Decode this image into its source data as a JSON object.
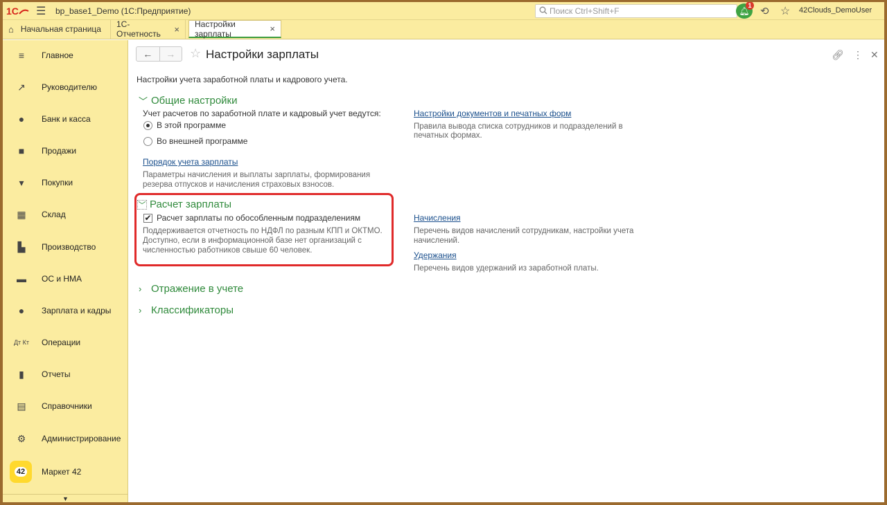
{
  "app": {
    "title": "bp_base1_Demo  (1С:Предприятие)",
    "search_placeholder": "Поиск Ctrl+Shift+F",
    "notifications_count": "1",
    "user": "42Clouds_DemoUser",
    "logo": "1С"
  },
  "tabs": [
    {
      "label": "Начальная страница"
    },
    {
      "label": "1С-Отчетность"
    },
    {
      "label": "Настройки зарплаты"
    }
  ],
  "sidebar": {
    "items": [
      {
        "label": "Главное",
        "icon": "menu-lines-icon"
      },
      {
        "label": "Руководителю",
        "icon": "trend-icon"
      },
      {
        "label": "Банк и касса",
        "icon": "coin-icon"
      },
      {
        "label": "Продажи",
        "icon": "bag-icon"
      },
      {
        "label": "Покупки",
        "icon": "cart-icon"
      },
      {
        "label": "Склад",
        "icon": "warehouse-icon"
      },
      {
        "label": "Производство",
        "icon": "factory-icon"
      },
      {
        "label": "ОС и НМА",
        "icon": "truck-icon"
      },
      {
        "label": "Зарплата и кадры",
        "icon": "person-icon"
      },
      {
        "label": "Операции",
        "icon": "operations-icon"
      },
      {
        "label": "Отчеты",
        "icon": "bar-chart-icon"
      },
      {
        "label": "Справочники",
        "icon": "books-icon"
      },
      {
        "label": "Администрирование",
        "icon": "gear-icon"
      },
      {
        "label": "Маркет 42",
        "icon": "market42-icon"
      }
    ],
    "market_badge": "42"
  },
  "page": {
    "title": "Настройки зарплаты",
    "description": "Настройки учета заработной платы и кадрового учета."
  },
  "general": {
    "title": "Общие настройки",
    "question": "Учет расчетов по заработной плате и кадровый учет ведутся:",
    "option_this": "В этой программе",
    "option_external": "Во внешней программе",
    "order_link": "Порядок учета зарплаты",
    "order_note_1": "Параметры начисления и выплаты зарплаты, формирования",
    "order_note_2": "резерва отпусков и начисления страховых взносов.",
    "docs_link": "Настройки документов и печатных форм",
    "docs_note_1": "Правила вывода списка сотрудников и подразделений в",
    "docs_note_2": "печатных формах."
  },
  "payroll": {
    "title": "Расчет зарплаты",
    "separate_label": "Расчет зарплаты по обособленным подразделениям",
    "note_1": "Поддерживается отчетность по НДФЛ по разным КПП и ОКТМО.",
    "note_2": "Доступно, если в информационной базе нет организаций с",
    "note_3": "численностью работников свыше 60 человек.",
    "accruals_link": "Начисления",
    "accruals_note_1": "Перечень видов начислений сотрудникам, настройки учета",
    "accruals_note_2": "начислений.",
    "deductions_link": "Удержания",
    "deductions_note": "Перечень видов удержаний из заработной платы."
  },
  "collapsed_sections": {
    "accounting": "Отражение в учете",
    "classifiers": "Классификаторы"
  }
}
